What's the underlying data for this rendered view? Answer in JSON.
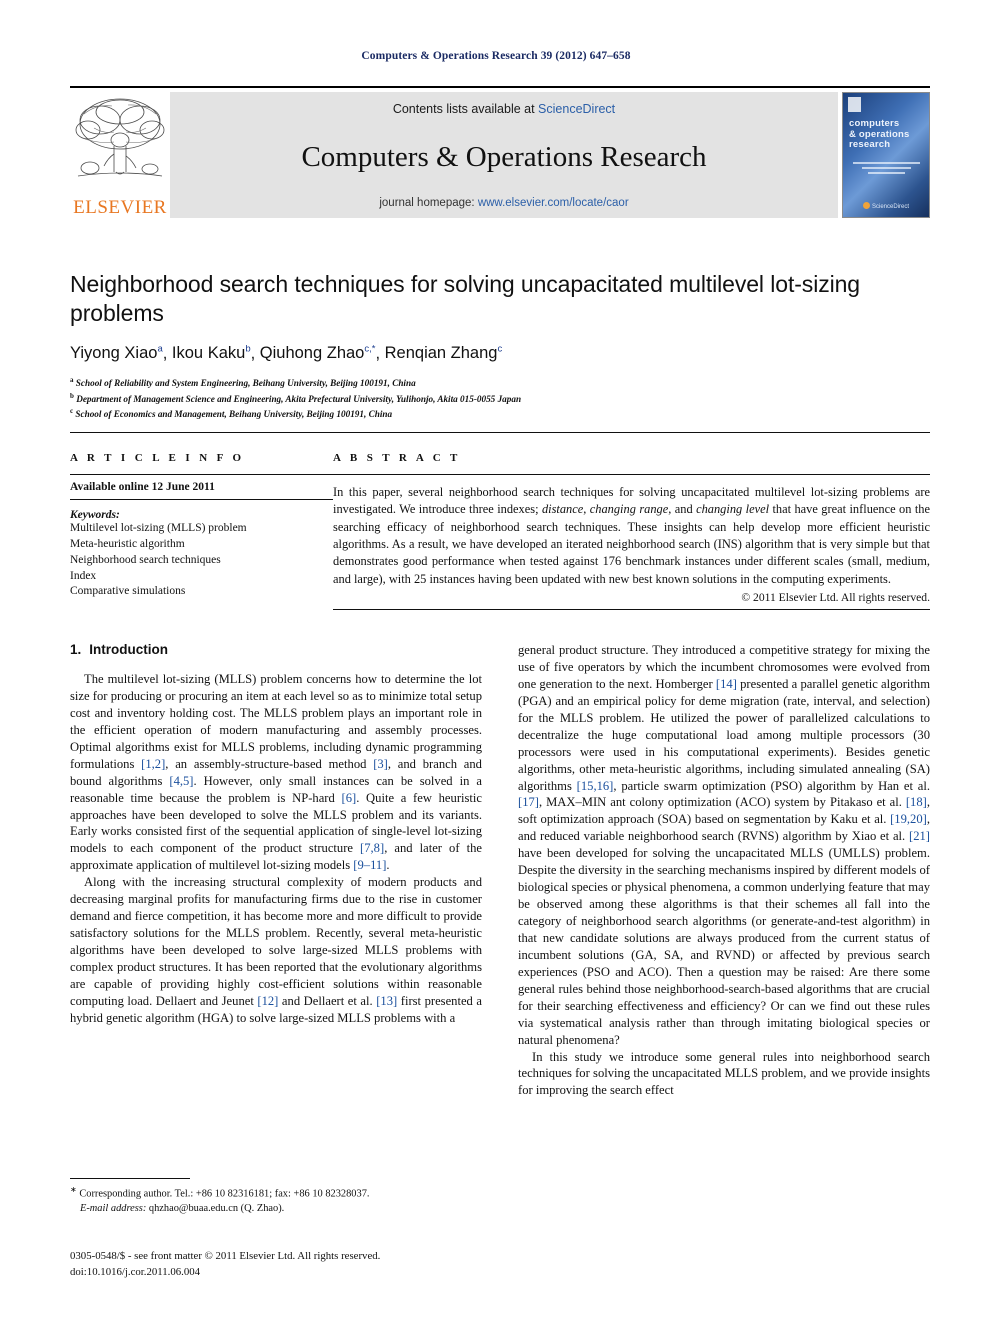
{
  "running_head": "Computers & Operations Research 39 (2012) 647–658",
  "header": {
    "contents_prefix": "Contents lists available at ",
    "sciencedirect": "ScienceDirect",
    "journal_title": "Computers & Operations Research",
    "homepage_prefix": "journal homepage: ",
    "homepage_url": "www.elsevier.com/locate/caor",
    "publisher": "ELSEVIER",
    "cover": {
      "title_line1": "computers",
      "title_line2": "& operations",
      "title_line3": "research",
      "footer": "ScienceDirect"
    },
    "link_color": "#2b5fa8",
    "band_color": "#e3e3e3",
    "elsevier_orange": "#E87722"
  },
  "article": {
    "title": "Neighborhood search techniques for solving uncapacitated multilevel lot-sizing problems",
    "authors": [
      {
        "name": "Yiyong Xiao",
        "marks": "a"
      },
      {
        "name": "Ikou Kaku",
        "marks": "b"
      },
      {
        "name": "Qiuhong Zhao",
        "marks": "c,*"
      },
      {
        "name": "Renqian Zhang",
        "marks": "c"
      }
    ],
    "affiliations": [
      {
        "mark": "a",
        "text": "School of Reliability and System Engineering, Beihang University, Beijing 100191, China"
      },
      {
        "mark": "b",
        "text": "Department of Management Science and Engineering, Akita Prefectural University, Yulihonjo, Akita 015-0055 Japan"
      },
      {
        "mark": "c",
        "text": "School of Economics and Management, Beihang University, Beijing 100191, China"
      }
    ]
  },
  "article_info": {
    "heading": "A R T I C L E  I N F O",
    "available": "Available online 12 June 2011",
    "keywords_label": "Keywords:",
    "keywords": [
      "Multilevel lot-sizing (MLLS) problem",
      "Meta-heuristic algorithm",
      "Neighborhood search techniques",
      "Index",
      "Comparative simulations"
    ]
  },
  "abstract": {
    "heading": "A B S T R A C T",
    "part1": "In this paper, several neighborhood search techniques for solving uncapacitated multilevel lot-sizing problems are investigated. We introduce three indexes; ",
    "italic1": "distance",
    "sep1": ", ",
    "italic2": "changing range",
    "sep2": ", and ",
    "italic3": "changing level",
    "part2": " that have great influence on the searching efficacy of neighborhood search techniques. These insights can help develop more efficient heuristic algorithms. As a result, we have developed an iterated neighborhood search (INS) algorithm that is very simple but that demonstrates good performance when tested against 176 benchmark instances under different scales (small, medium, and large), with 25 instances having been updated with new best known solutions in the computing experiments.",
    "copyright": "© 2011 Elsevier Ltd. All rights reserved."
  },
  "introduction": {
    "number": "1.",
    "heading": "Introduction",
    "left_paragraphs": [
      "The multilevel lot-sizing (MLLS) problem concerns how to determine the lot size for producing or procuring an item at each level so as to minimize total setup cost and inventory holding cost. The MLLS problem plays an important role in the efficient operation of modern manufacturing and assembly processes. Optimal algorithms exist for MLLS problems, including dynamic programming formulations [1,2], an assembly-structure-based method [3], and branch and bound algorithms [4,5]. However, only small instances can be solved in a reasonable time because the problem is NP-hard [6]. Quite a few heuristic approaches have been developed to solve the MLLS problem and its variants. Early works consisted first of the sequential application of single-level lot-sizing models to each component of the product structure [7,8], and later of the approximate application of multilevel lot-sizing models [9–11].",
      "Along with the increasing structural complexity of modern products and decreasing marginal profits for manufacturing firms due to the rise in customer demand and fierce competition, it has become more and more difficult to provide satisfactory solutions for the MLLS problem. Recently, several meta-heuristic algorithms have been developed to solve large-sized MLLS problems with complex product structures. It has been reported that the evolutionary algorithms are capable of providing highly cost-efficient solutions within reasonable computing load. Dellaert and Jeunet [12] and Dellaert et al. [13] first presented a hybrid genetic algorithm (HGA) to solve large-sized MLLS problems with a"
    ],
    "right_paragraphs": [
      "general product structure. They introduced a competitive strategy for mixing the use of five operators by which the incumbent chromosomes were evolved from one generation to the next. Homberger [14] presented a parallel genetic algorithm (PGA) and an empirical policy for deme migration (rate, interval, and selection) for the MLLS problem. He utilized the power of parallelized calculations to decentralize the huge computational load among multiple processors (30 processors were used in his computational experiments). Besides genetic algorithms, other meta-heuristic algorithms, including simulated annealing (SA) algorithms [15,16], particle swarm optimization (PSO) algorithm by Han et al. [17], MAX–MIN ant colony optimization (ACO) system by Pitakaso et al. [18], soft optimization approach (SOA) based on segmentation by Kaku et al. [19,20], and reduced variable neighborhood search (RVNS) algorithm by Xiao et al. [21] have been developed for solving the uncapacitated MLLS (UMLLS) problem. Despite the diversity in the searching mechanisms inspired by different models of biological species or physical phenomena, a common underlying feature that may be observed among these algorithms is that their schemes all fall into the category of neighborhood search algorithms (or generate-and-test algorithm) in that new candidate solutions are always produced from the current status of incumbent solutions (GA, SA, and RVND) or affected by previous search experiences (PSO and ACO). Then a question may be raised: Are there some general rules behind those neighborhood-search-based algorithms that are crucial for their searching effectiveness and efficiency? Or can we find out these rules via systematical analysis rather than through imitating biological species or natural phenomena?",
      "In this study we introduce some general rules into neighborhood search techniques for solving the uncapacitated MLLS problem, and we provide insights for improving the search effect"
    ],
    "reference_color": "#1a4f9c"
  },
  "footnotes": {
    "corresponding": "Corresponding author. Tel.: +86 10 82316181; fax: +86 10 82328037.",
    "email_label": "E-mail address:",
    "email": "qhzhao@buaa.edu.cn (Q. Zhao)."
  },
  "imprint": {
    "line1": "0305-0548/$ - see front matter © 2011 Elsevier Ltd. All rights reserved.",
    "line2": "doi:10.1016/j.cor.2011.06.004"
  }
}
